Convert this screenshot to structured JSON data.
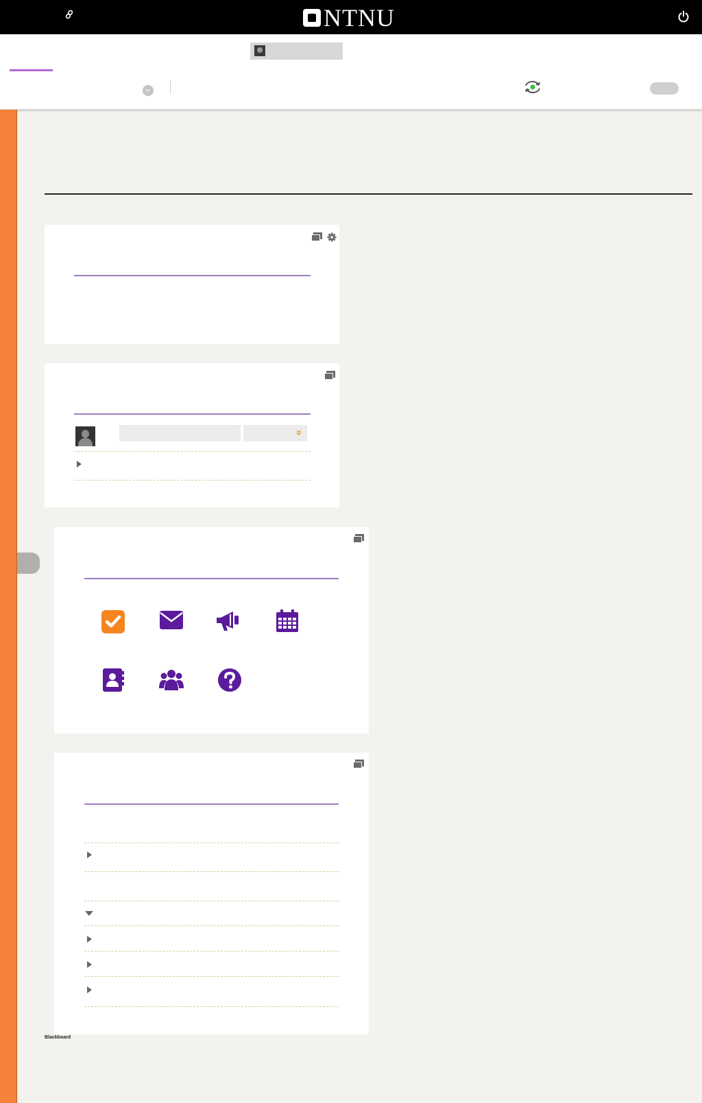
{
  "brand": {
    "logo_text": "NTNU",
    "footer": "Blackboard"
  },
  "icons": {
    "top_left": "link-icon",
    "top_right": "power-icon",
    "sync": "sync-icon",
    "module_tools": [
      "collapse-icon",
      "gear-icon"
    ],
    "tools": [
      "tasks-icon",
      "mail-icon",
      "announcements-icon",
      "calendar-icon",
      "contacts-icon",
      "groups-icon",
      "help-icon"
    ]
  },
  "colors": {
    "top_bar": "#000000",
    "accent_purple": "#5b1b9c",
    "tab_underline": "#b667d4",
    "module_rule": "#9b7ebd",
    "side_strip": "#f4823a",
    "tasks_icon_bg": "#f7851f",
    "page_bg": "#f3f2ee"
  }
}
